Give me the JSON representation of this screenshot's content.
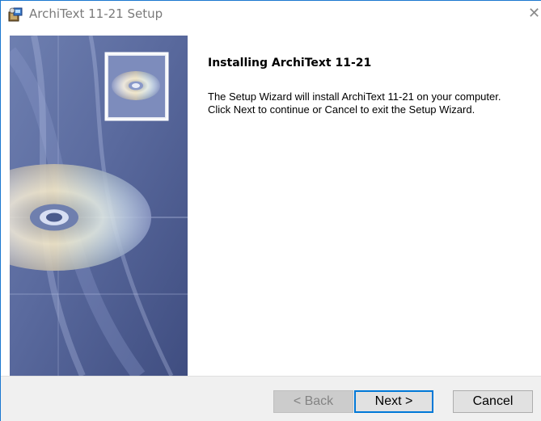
{
  "window": {
    "title": "ArchiText 11-21 Setup",
    "close_glyph": "✕",
    "icons": {
      "app": "setup-package-icon",
      "close": "close-icon",
      "banner_disc": "cd-disc-icon"
    }
  },
  "content": {
    "heading": "Installing ArchiText 11-21",
    "description_line1": "The Setup Wizard will install ArchiText 11-21 on your computer.",
    "description_line2": "Click Next to continue or Cancel to exit the Setup Wizard."
  },
  "buttons": {
    "back": "< Back",
    "next": "Next >",
    "cancel": "Cancel"
  },
  "colors": {
    "accent": "#0078d7",
    "banner": "#5a6a9a",
    "footer": "#f0f0f0"
  }
}
